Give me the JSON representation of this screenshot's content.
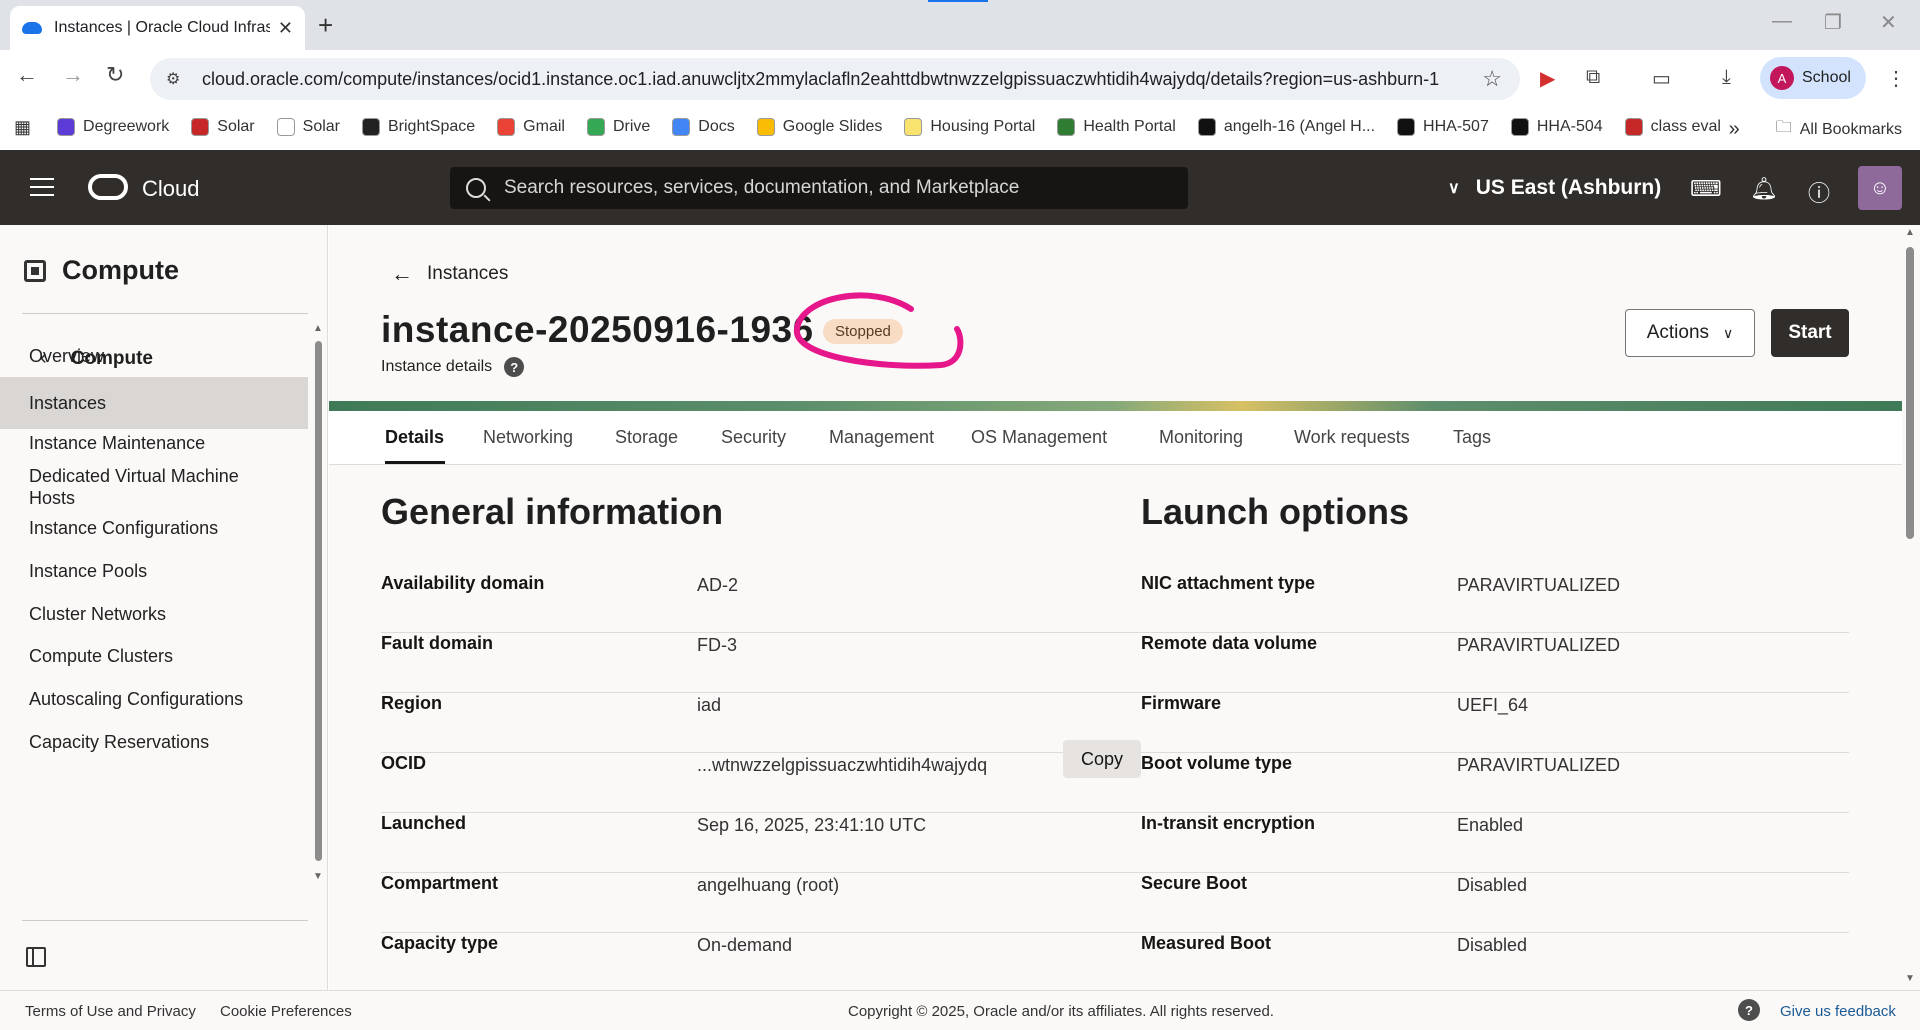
{
  "browser": {
    "tab_title": "Instances | Oracle Cloud Infrastru",
    "new_tab": "+",
    "close": "✕",
    "url": "cloud.oracle.com/compute/instances/ocid1.instance.oc1.iad.anuwcljtx2mmylaclafln2eahttdbwtnwzzelgpissuaczwhtidih4wajydq/details?region=us-ashburn-1",
    "profile_initial": "A",
    "profile_name": "School"
  },
  "bookmarks": [
    {
      "label": "Degreework",
      "color": "#5c3bd6"
    },
    {
      "label": "Solar",
      "color": "#c62828"
    },
    {
      "label": "Solar",
      "color": "#ffffff"
    },
    {
      "label": "BrightSpace",
      "color": "#222222"
    },
    {
      "label": "Gmail",
      "color": "#ea4335"
    },
    {
      "label": "Drive",
      "color": "#34a853"
    },
    {
      "label": "Docs",
      "color": "#4285f4"
    },
    {
      "label": "Google Slides",
      "color": "#fbbc04"
    },
    {
      "label": "Housing Portal",
      "color": "#f7e36d"
    },
    {
      "label": "Health Portal",
      "color": "#2e7d32"
    },
    {
      "label": "angelh-16 (Angel H...",
      "color": "#111111"
    },
    {
      "label": "HHA-507",
      "color": "#111111"
    },
    {
      "label": "HHA-504",
      "color": "#111111"
    },
    {
      "label": "class eval",
      "color": "#c62828"
    }
  ],
  "bookmarks_more": "»",
  "all_bookmarks": "All Bookmarks",
  "oci": {
    "brand": "Cloud",
    "search_placeholder": "Search resources, services, documentation, and Marketplace",
    "region": "US East (Ashburn)"
  },
  "sidebar": {
    "title": "Compute",
    "back_label": "Compute",
    "items": [
      {
        "label": "Overview",
        "active": false
      },
      {
        "label": "Instances",
        "active": true
      },
      {
        "label": "Instance Maintenance",
        "active": false
      },
      {
        "label": "Dedicated Virtual Machine Hosts",
        "active": false
      },
      {
        "label": "Instance Configurations",
        "active": false
      },
      {
        "label": "Instance Pools",
        "active": false
      },
      {
        "label": "Cluster Networks",
        "active": false
      },
      {
        "label": "Compute Clusters",
        "active": false
      },
      {
        "label": "Autoscaling Configurations",
        "active": false
      },
      {
        "label": "Capacity Reservations",
        "active": false
      }
    ]
  },
  "page": {
    "back_label": "Instances",
    "title": "instance-20250916-1936",
    "status": "Stopped",
    "subtitle": "Instance details",
    "actions_label": "Actions",
    "start_label": "Start",
    "annotation_color": "#e6178b"
  },
  "tabs": [
    "Details",
    "Networking",
    "Storage",
    "Security",
    "Management",
    "OS Management",
    "Monitoring",
    "Work requests",
    "Tags"
  ],
  "general_information": {
    "title": "General information",
    "rows": [
      {
        "key": "Availability domain",
        "value": "AD-2"
      },
      {
        "key": "Fault domain",
        "value": "FD-3"
      },
      {
        "key": "Region",
        "value": "iad"
      },
      {
        "key": "OCID",
        "value": "...wtnwzzelgpissuaczwhtidih4wajydq"
      },
      {
        "key": "Launched",
        "value": "Sep 16, 2025, 23:41:10 UTC"
      },
      {
        "key": "Compartment",
        "value": "angelhuang (root)"
      },
      {
        "key": "Capacity type",
        "value": "On-demand"
      }
    ],
    "copy_label": "Copy"
  },
  "launch_options": {
    "title": "Launch options",
    "rows": [
      {
        "key": "NIC attachment type",
        "value": "PARAVIRTUALIZED"
      },
      {
        "key": "Remote data volume",
        "value": "PARAVIRTUALIZED"
      },
      {
        "key": "Firmware",
        "value": "UEFI_64"
      },
      {
        "key": "Boot volume type",
        "value": "PARAVIRTUALIZED"
      },
      {
        "key": "In-transit encryption",
        "value": "Enabled"
      },
      {
        "key": "Secure Boot",
        "value": "Disabled"
      },
      {
        "key": "Measured Boot",
        "value": "Disabled"
      }
    ]
  },
  "footer": {
    "terms": "Terms of Use and Privacy",
    "cookies": "Cookie Preferences",
    "copyright": "Copyright © 2025, Oracle and/or its affiliates. All rights reserved.",
    "feedback": "Give us feedback"
  }
}
